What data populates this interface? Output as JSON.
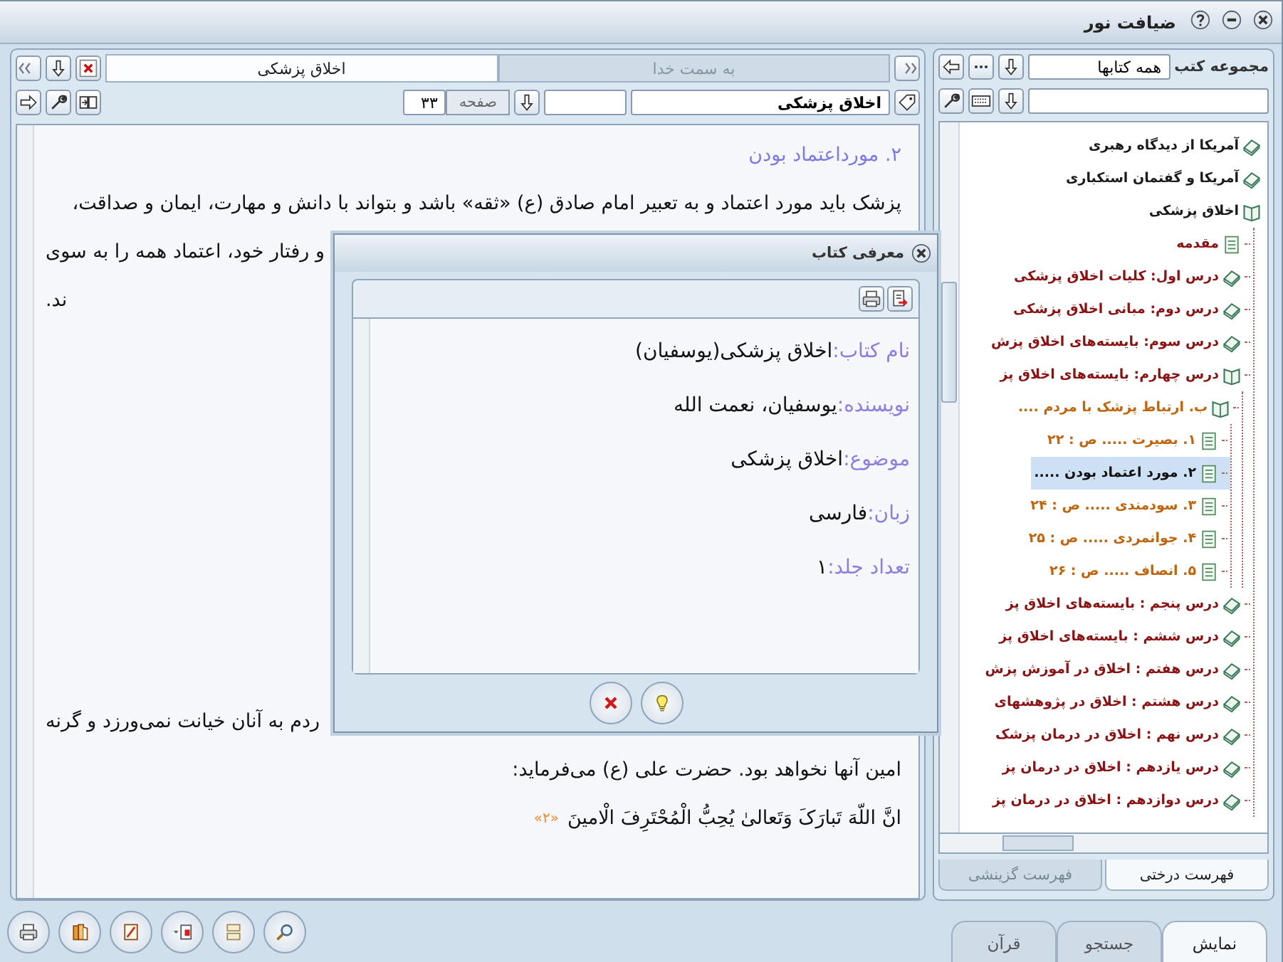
{
  "window": {
    "title": "ضیافت نور"
  },
  "library": {
    "collection_label": "مجموعه کتب",
    "collection_value": "همه کتابها",
    "tree": [
      {
        "label": "آمریکا از دیدگاه رهبری",
        "kind": "book",
        "expanded": false,
        "selected": false
      },
      {
        "label": "آمریکا و گفتمان استکباری",
        "kind": "book",
        "expanded": false,
        "selected": false
      },
      {
        "label": "اخلاق پزشکی",
        "kind": "book",
        "expanded": true,
        "selected": false,
        "children": [
          {
            "label": "مقدمه",
            "kind": "page",
            "selected": false
          },
          {
            "label": "درس اول: کلیات اخلاق پزشکی",
            "kind": "book",
            "expanded": false,
            "selected": false
          },
          {
            "label": "درس دوم: مبانی اخلاق پزشکی",
            "kind": "book",
            "expanded": false,
            "selected": false
          },
          {
            "label": "درس سوم: بایسته‌های اخلاق پزش",
            "kind": "book",
            "expanded": false,
            "selected": false
          },
          {
            "label": "درس چهارم: بایسته‌های اخلاق پز",
            "kind": "book",
            "expanded": true,
            "selected": false,
            "children": [
              {
                "label": "ب. ارتباط پزشک با مردم ....",
                "kind": "book",
                "expanded": true,
                "selected": false,
                "children": [
                  {
                    "label": "۱. بصیرت ..... ص : ۲۲",
                    "kind": "page",
                    "selected": false
                  },
                  {
                    "label": "۲. مورد اعتماد بودن .....",
                    "kind": "page",
                    "selected": true
                  },
                  {
                    "label": "۳. سودمندی ..... ص : ۲۴",
                    "kind": "page",
                    "selected": false
                  },
                  {
                    "label": "۴. جوانمردی ..... ص : ۲۵",
                    "kind": "page",
                    "selected": false
                  },
                  {
                    "label": "۵. انصاف ..... ص : ۲۶",
                    "kind": "page",
                    "selected": false
                  }
                ]
              }
            ]
          },
          {
            "label": "درس پنجم : بایسته‌های اخلاق پز",
            "kind": "book",
            "expanded": false,
            "selected": false
          },
          {
            "label": "درس ششم : بایسته‌های اخلاق پز",
            "kind": "book",
            "expanded": false,
            "selected": false
          },
          {
            "label": "درس هفتم : اخلاق در آموزش پزش",
            "kind": "book",
            "expanded": false,
            "selected": false
          },
          {
            "label": "درس هشتم : اخلاق در پژوهشهای",
            "kind": "book",
            "expanded": false,
            "selected": false
          },
          {
            "label": "درس نهم : اخلاق در درمان پزشک",
            "kind": "book",
            "expanded": false,
            "selected": false
          },
          {
            "label": "درس یازدهم : اخلاق در درمان پز",
            "kind": "book",
            "expanded": false,
            "selected": false
          },
          {
            "label": "درس دوازدهم : اخلاق در درمان پز",
            "kind": "book",
            "expanded": false,
            "selected": false
          }
        ]
      }
    ]
  },
  "list_tabs": [
    {
      "label": "فهرست درختی",
      "selected": true
    },
    {
      "label": "فهرست گزینشی",
      "selected": false
    }
  ],
  "reader": {
    "tabs": [
      {
        "label": "به سمت خدا",
        "selected": false
      },
      {
        "label": "اخلاق پزشکی",
        "selected": true
      }
    ],
    "book_field": "اخلاق پزشکی",
    "page_label": "صفحه",
    "page_value": "۳۳",
    "lines_top": [
      {
        "kind": "heading",
        "text": "۲. مورداعتماد بودن"
      },
      {
        "kind": "text",
        "text": "پزشک باید مورد اعتماد و به تعبیر امام صادق (ع) «ثقه» باشد و بتواند با دانش و مهارت، ایمان و صداقت،"
      },
      {
        "kind": "fragment",
        "text": "و رفتار خود، اعتماد همه را به سوی"
      },
      {
        "kind": "fragment",
        "text": "ند."
      }
    ],
    "lines_bottom": [
      {
        "kind": "fragment",
        "text": "ردم به آنان خیانت نمی‌ورزد و گرنه"
      },
      {
        "kind": "text",
        "text": "امین آنها نخواهد بود. حضرت علی (ع) می‌فرماید:"
      },
      {
        "kind": "verse",
        "text": "انَّ اللّهَ تَبارَکَ وَتَعالیٰ یُحِبُّ الْمُحْتَرِفَ الْامینَ",
        "footnote": "«۲»"
      }
    ]
  },
  "dialog": {
    "title": "معرفی کتاب",
    "fields": [
      {
        "label": "نام کتاب:",
        "value": "اخلاق پزشکی(یوسفیان)"
      },
      {
        "label": "نویسنده:",
        "value": "یوسفیان، نعمت الله"
      },
      {
        "label": "موضوع:",
        "value": "اخلاق پزشکی"
      },
      {
        "label": "زبان:",
        "value": "فارسی"
      },
      {
        "label": "تعداد جلد:",
        "value": "۱"
      }
    ]
  },
  "bottom_tabs": [
    {
      "label": "نمایش",
      "selected": true
    },
    {
      "label": "جستجو",
      "selected": false
    },
    {
      "label": "قرآن",
      "selected": false
    }
  ]
}
